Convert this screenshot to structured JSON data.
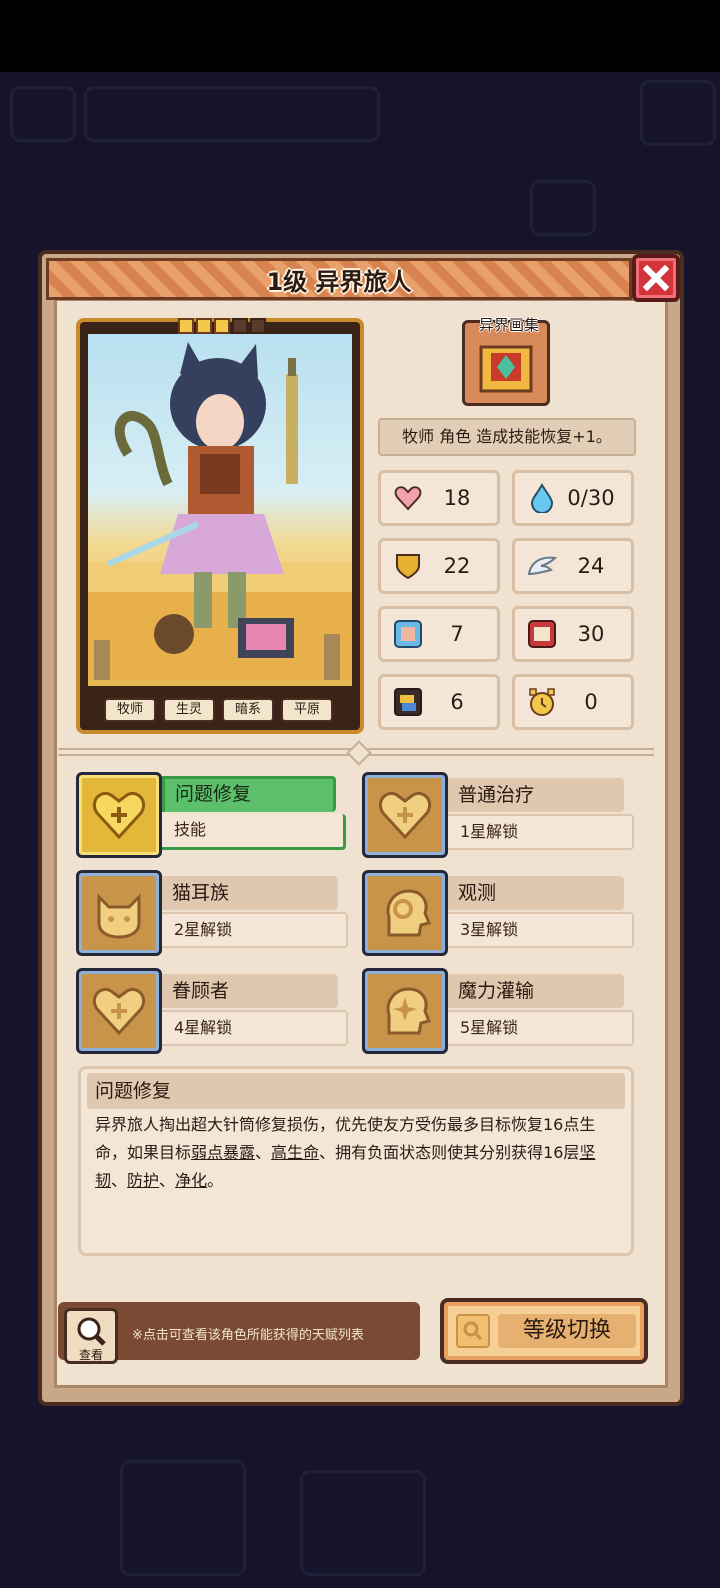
{
  "header": {
    "title": "1级 异界旅人"
  },
  "character": {
    "stars_filled": 3,
    "stars_total": 5,
    "tags": [
      "牧师",
      "生灵",
      "暗系",
      "平原"
    ]
  },
  "gallery": {
    "label": "异界画集"
  },
  "trait_description": "牧师 角色 造成技能恢复+1。",
  "stats": [
    {
      "icon": "heart-icon",
      "value": "18"
    },
    {
      "icon": "water-drop-icon",
      "value": "0/30"
    },
    {
      "icon": "shield-icon",
      "value": "22"
    },
    {
      "icon": "wing-icon",
      "value": "24"
    },
    {
      "icon": "fist-icon",
      "value": "7"
    },
    {
      "icon": "book-icon",
      "value": "30"
    },
    {
      "icon": "card-icon",
      "value": "6"
    },
    {
      "icon": "alarm-clock-icon",
      "value": "0"
    }
  ],
  "skills": [
    {
      "name": "问题修复",
      "sub": "技能",
      "icon": "heart-plus-icon",
      "active": true
    },
    {
      "name": "普通治疗",
      "sub": "1星解锁",
      "icon": "heart-plus-icon",
      "active": false
    },
    {
      "name": "猫耳族",
      "sub": "2星解锁",
      "icon": "cat-face-icon",
      "active": false
    },
    {
      "name": "观测",
      "sub": "3星解锁",
      "icon": "head-gear-icon",
      "active": false
    },
    {
      "name": "眷顾者",
      "sub": "4星解锁",
      "icon": "heart-plus-icon",
      "active": false
    },
    {
      "name": "魔力灌输",
      "sub": "5星解锁",
      "icon": "head-sparkle-icon",
      "active": false
    }
  ],
  "detail": {
    "title": "问题修复",
    "segments": [
      {
        "text": "异界旅人掏出超大针筒修复损伤，优先使友方受伤最多目标恢复16点生命，如果目标",
        "kw": false
      },
      {
        "text": "弱点暴露",
        "kw": true
      },
      {
        "text": "、",
        "kw": false
      },
      {
        "text": "高生命",
        "kw": true
      },
      {
        "text": "、拥有负面状态则使其分别获得16层",
        "kw": false
      },
      {
        "text": "坚韧",
        "kw": true
      },
      {
        "text": "、",
        "kw": false
      },
      {
        "text": "防护",
        "kw": true
      },
      {
        "text": "、",
        "kw": false
      },
      {
        "text": "净化",
        "kw": true
      },
      {
        "text": "。",
        "kw": false
      }
    ]
  },
  "footer": {
    "view_label": "查看",
    "hint": "※点击可查看该角色所能获得的天赋列表",
    "level_switch": "等级切换"
  },
  "colors": {
    "frame": "#4a2c20",
    "panel": "#efe2d0",
    "accent_green": "#5cbf6a",
    "gold": "#e2b73a",
    "close_red": "#d2343c"
  }
}
